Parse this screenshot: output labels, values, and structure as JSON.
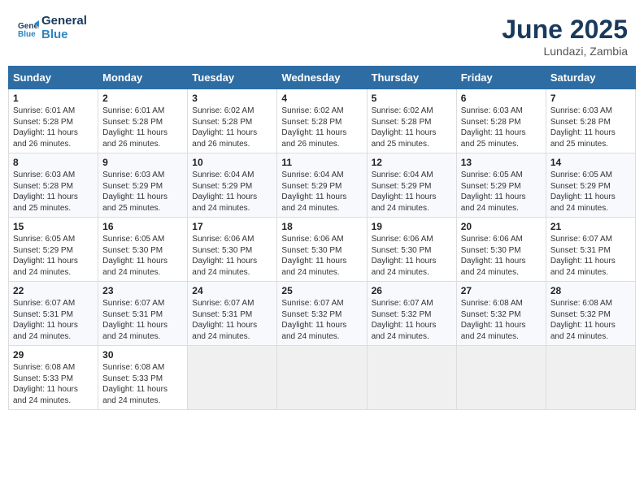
{
  "logo": {
    "line1": "General",
    "line2": "Blue"
  },
  "title": {
    "month_year": "June 2025",
    "location": "Lundazi, Zambia"
  },
  "calendar": {
    "headers": [
      "Sunday",
      "Monday",
      "Tuesday",
      "Wednesday",
      "Thursday",
      "Friday",
      "Saturday"
    ],
    "weeks": [
      [
        {
          "day": "1",
          "info": "Sunrise: 6:01 AM\nSunset: 5:28 PM\nDaylight: 11 hours and 26 minutes."
        },
        {
          "day": "2",
          "info": "Sunrise: 6:01 AM\nSunset: 5:28 PM\nDaylight: 11 hours and 26 minutes."
        },
        {
          "day": "3",
          "info": "Sunrise: 6:02 AM\nSunset: 5:28 PM\nDaylight: 11 hours and 26 minutes."
        },
        {
          "day": "4",
          "info": "Sunrise: 6:02 AM\nSunset: 5:28 PM\nDaylight: 11 hours and 26 minutes."
        },
        {
          "day": "5",
          "info": "Sunrise: 6:02 AM\nSunset: 5:28 PM\nDaylight: 11 hours and 25 minutes."
        },
        {
          "day": "6",
          "info": "Sunrise: 6:03 AM\nSunset: 5:28 PM\nDaylight: 11 hours and 25 minutes."
        },
        {
          "day": "7",
          "info": "Sunrise: 6:03 AM\nSunset: 5:28 PM\nDaylight: 11 hours and 25 minutes."
        }
      ],
      [
        {
          "day": "8",
          "info": "Sunrise: 6:03 AM\nSunset: 5:28 PM\nDaylight: 11 hours and 25 minutes."
        },
        {
          "day": "9",
          "info": "Sunrise: 6:03 AM\nSunset: 5:29 PM\nDaylight: 11 hours and 25 minutes."
        },
        {
          "day": "10",
          "info": "Sunrise: 6:04 AM\nSunset: 5:29 PM\nDaylight: 11 hours and 24 minutes."
        },
        {
          "day": "11",
          "info": "Sunrise: 6:04 AM\nSunset: 5:29 PM\nDaylight: 11 hours and 24 minutes."
        },
        {
          "day": "12",
          "info": "Sunrise: 6:04 AM\nSunset: 5:29 PM\nDaylight: 11 hours and 24 minutes."
        },
        {
          "day": "13",
          "info": "Sunrise: 6:05 AM\nSunset: 5:29 PM\nDaylight: 11 hours and 24 minutes."
        },
        {
          "day": "14",
          "info": "Sunrise: 6:05 AM\nSunset: 5:29 PM\nDaylight: 11 hours and 24 minutes."
        }
      ],
      [
        {
          "day": "15",
          "info": "Sunrise: 6:05 AM\nSunset: 5:29 PM\nDaylight: 11 hours and 24 minutes."
        },
        {
          "day": "16",
          "info": "Sunrise: 6:05 AM\nSunset: 5:30 PM\nDaylight: 11 hours and 24 minutes."
        },
        {
          "day": "17",
          "info": "Sunrise: 6:06 AM\nSunset: 5:30 PM\nDaylight: 11 hours and 24 minutes."
        },
        {
          "day": "18",
          "info": "Sunrise: 6:06 AM\nSunset: 5:30 PM\nDaylight: 11 hours and 24 minutes."
        },
        {
          "day": "19",
          "info": "Sunrise: 6:06 AM\nSunset: 5:30 PM\nDaylight: 11 hours and 24 minutes."
        },
        {
          "day": "20",
          "info": "Sunrise: 6:06 AM\nSunset: 5:30 PM\nDaylight: 11 hours and 24 minutes."
        },
        {
          "day": "21",
          "info": "Sunrise: 6:07 AM\nSunset: 5:31 PM\nDaylight: 11 hours and 24 minutes."
        }
      ],
      [
        {
          "day": "22",
          "info": "Sunrise: 6:07 AM\nSunset: 5:31 PM\nDaylight: 11 hours and 24 minutes."
        },
        {
          "day": "23",
          "info": "Sunrise: 6:07 AM\nSunset: 5:31 PM\nDaylight: 11 hours and 24 minutes."
        },
        {
          "day": "24",
          "info": "Sunrise: 6:07 AM\nSunset: 5:31 PM\nDaylight: 11 hours and 24 minutes."
        },
        {
          "day": "25",
          "info": "Sunrise: 6:07 AM\nSunset: 5:32 PM\nDaylight: 11 hours and 24 minutes."
        },
        {
          "day": "26",
          "info": "Sunrise: 6:07 AM\nSunset: 5:32 PM\nDaylight: 11 hours and 24 minutes."
        },
        {
          "day": "27",
          "info": "Sunrise: 6:08 AM\nSunset: 5:32 PM\nDaylight: 11 hours and 24 minutes."
        },
        {
          "day": "28",
          "info": "Sunrise: 6:08 AM\nSunset: 5:32 PM\nDaylight: 11 hours and 24 minutes."
        }
      ],
      [
        {
          "day": "29",
          "info": "Sunrise: 6:08 AM\nSunset: 5:33 PM\nDaylight: 11 hours and 24 minutes."
        },
        {
          "day": "30",
          "info": "Sunrise: 6:08 AM\nSunset: 5:33 PM\nDaylight: 11 hours and 24 minutes."
        },
        {
          "day": "",
          "info": ""
        },
        {
          "day": "",
          "info": ""
        },
        {
          "day": "",
          "info": ""
        },
        {
          "day": "",
          "info": ""
        },
        {
          "day": "",
          "info": ""
        }
      ]
    ]
  }
}
